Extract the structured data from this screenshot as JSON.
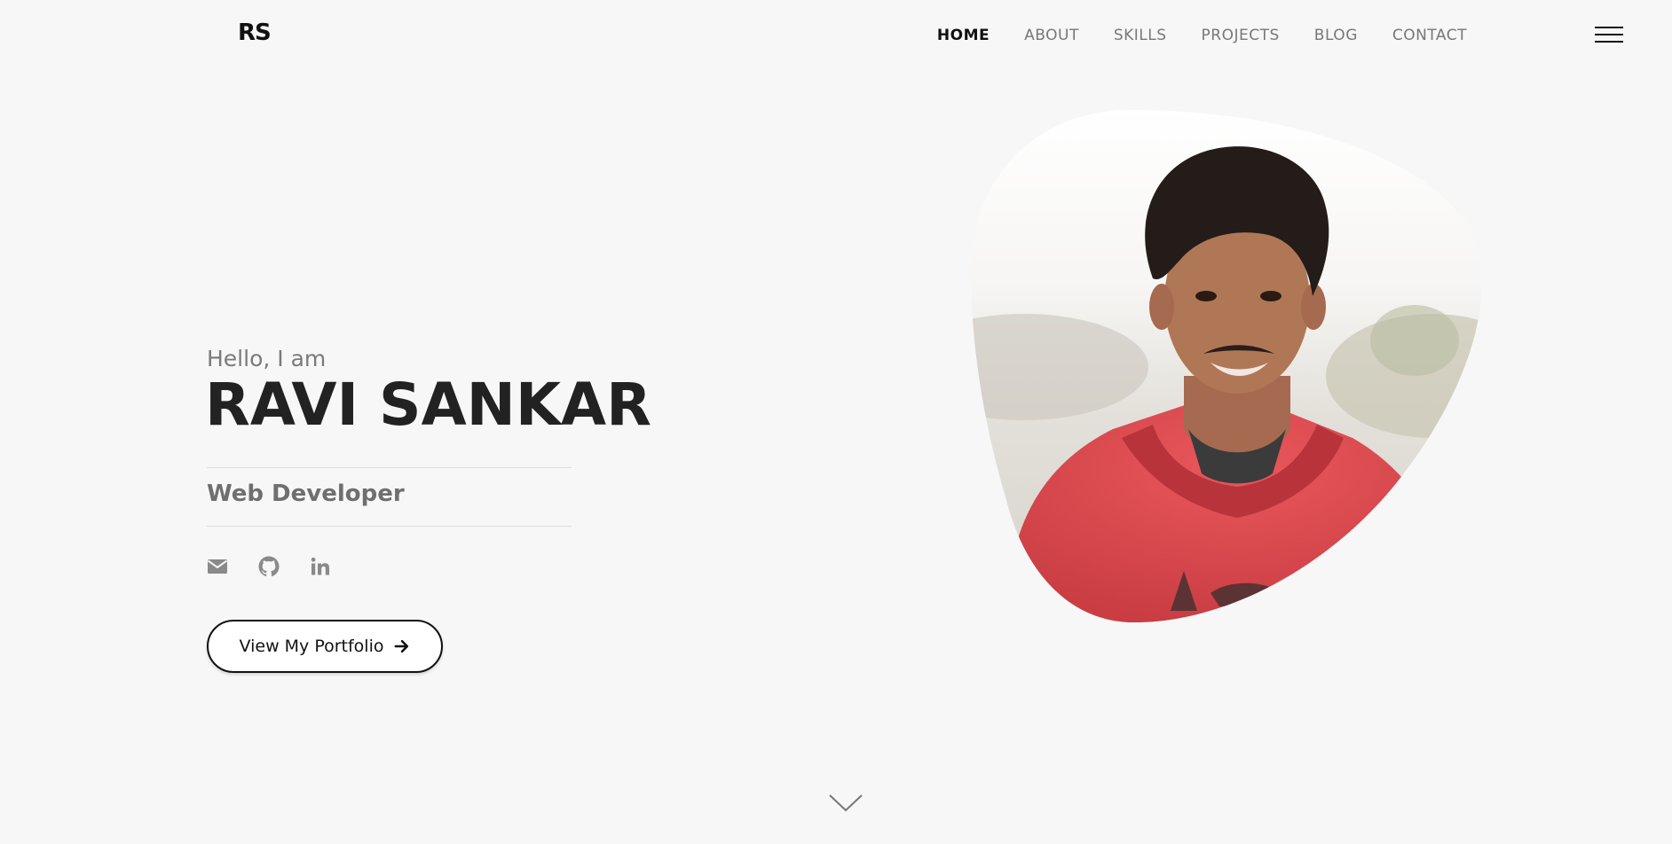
{
  "header": {
    "logo": "RS",
    "nav": [
      {
        "label": "HOME",
        "active": true
      },
      {
        "label": "ABOUT",
        "active": false
      },
      {
        "label": "SKILLS",
        "active": false
      },
      {
        "label": "PROJECTS",
        "active": false
      },
      {
        "label": "BLOG",
        "active": false
      },
      {
        "label": "CONTACT",
        "active": false
      }
    ],
    "menu_icon": "hamburger-icon"
  },
  "hero": {
    "greeting": "Hello, I am",
    "name": "RAVI SANKAR",
    "role": "Web Developer",
    "socials": [
      "envelope-icon",
      "github-icon",
      "linkedin-icon"
    ],
    "cta_label": "View My Portfolio",
    "cta_icon": "arrow-right-icon",
    "scroll_icon": "chevron-down-icon"
  },
  "colors": {
    "background": "#f7f7f7",
    "text_dark": "#222222",
    "text_muted": "#777777",
    "hoodie": "#e0474c"
  }
}
